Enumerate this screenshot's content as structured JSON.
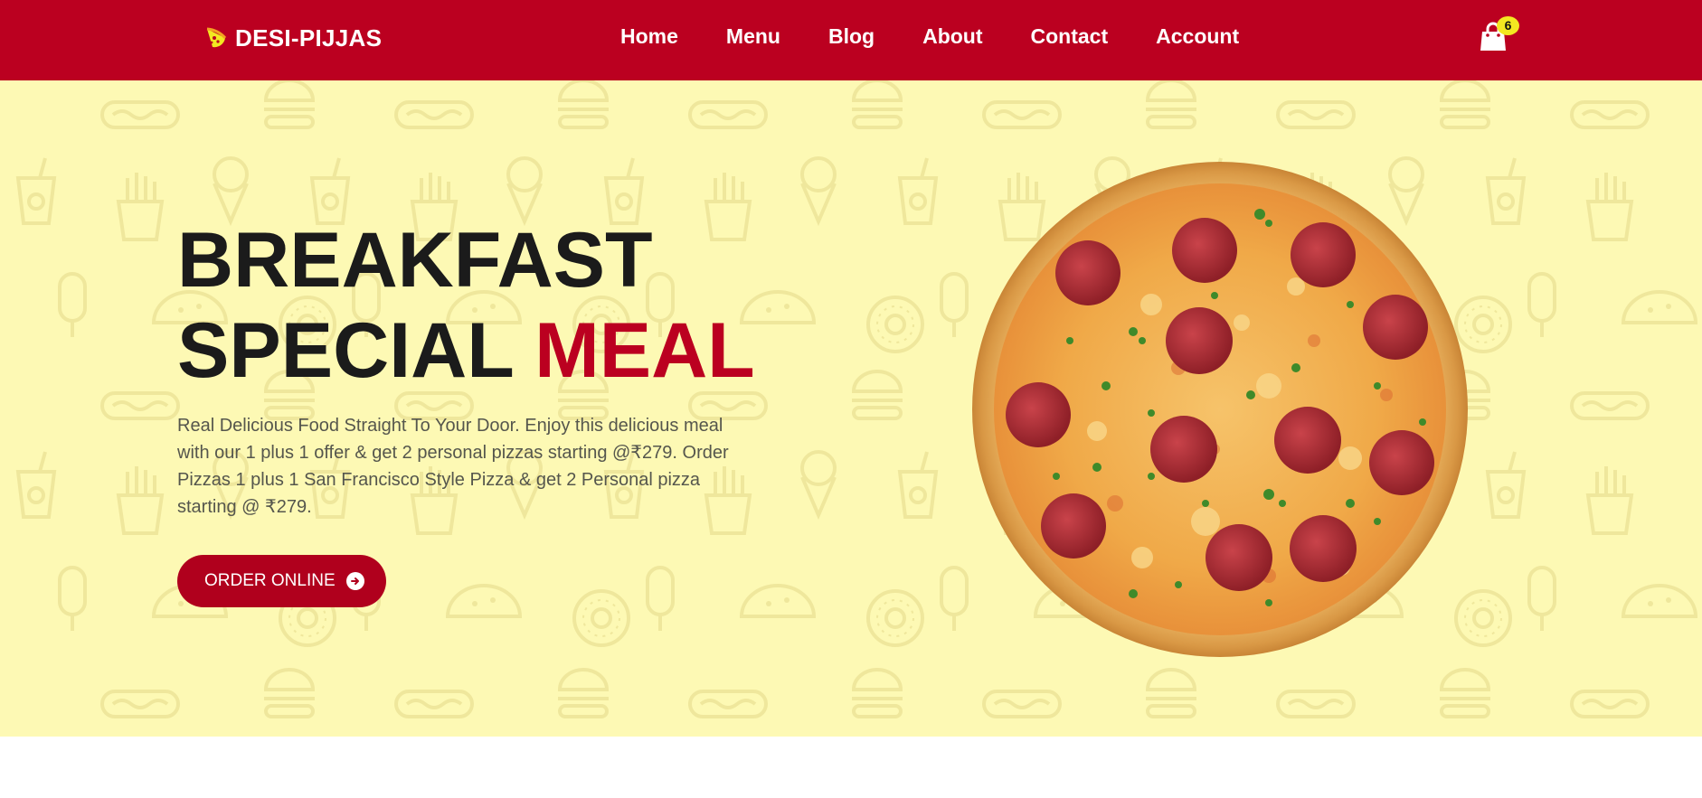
{
  "brand": {
    "name": "DESI-PIJJAS",
    "logo_icon": "pizza-slice-icon"
  },
  "nav": {
    "links": [
      {
        "label": "Home"
      },
      {
        "label": "Menu"
      },
      {
        "label": "Blog"
      },
      {
        "label": "About"
      },
      {
        "label": "Contact"
      },
      {
        "label": "Account"
      }
    ]
  },
  "cart": {
    "icon": "shopping-bag-icon",
    "count": "6"
  },
  "hero": {
    "headline_line1": "BREAKFAST",
    "headline_line2": "SPECIAL",
    "headline_accent": "MEAL",
    "description": "Real Delicious Food Straight To Your Door. Enjoy this delicious meal with our 1 plus 1 offer & get 2 personal pizzas starting @₹279. Order Pizzas 1 plus 1 San Francisco Style Pizza & get 2 Personal pizza starting @ ₹279.",
    "cta_label": "ORDER ONLINE",
    "cta_icon": "arrow-circle-right-icon",
    "image": "pepperoni-pizza-image"
  },
  "colors": {
    "brand_red": "#bb0020",
    "hero_background": "#fdf9b4",
    "badge_yellow": "#f3e821",
    "headline_dark": "#1b1b1b"
  }
}
